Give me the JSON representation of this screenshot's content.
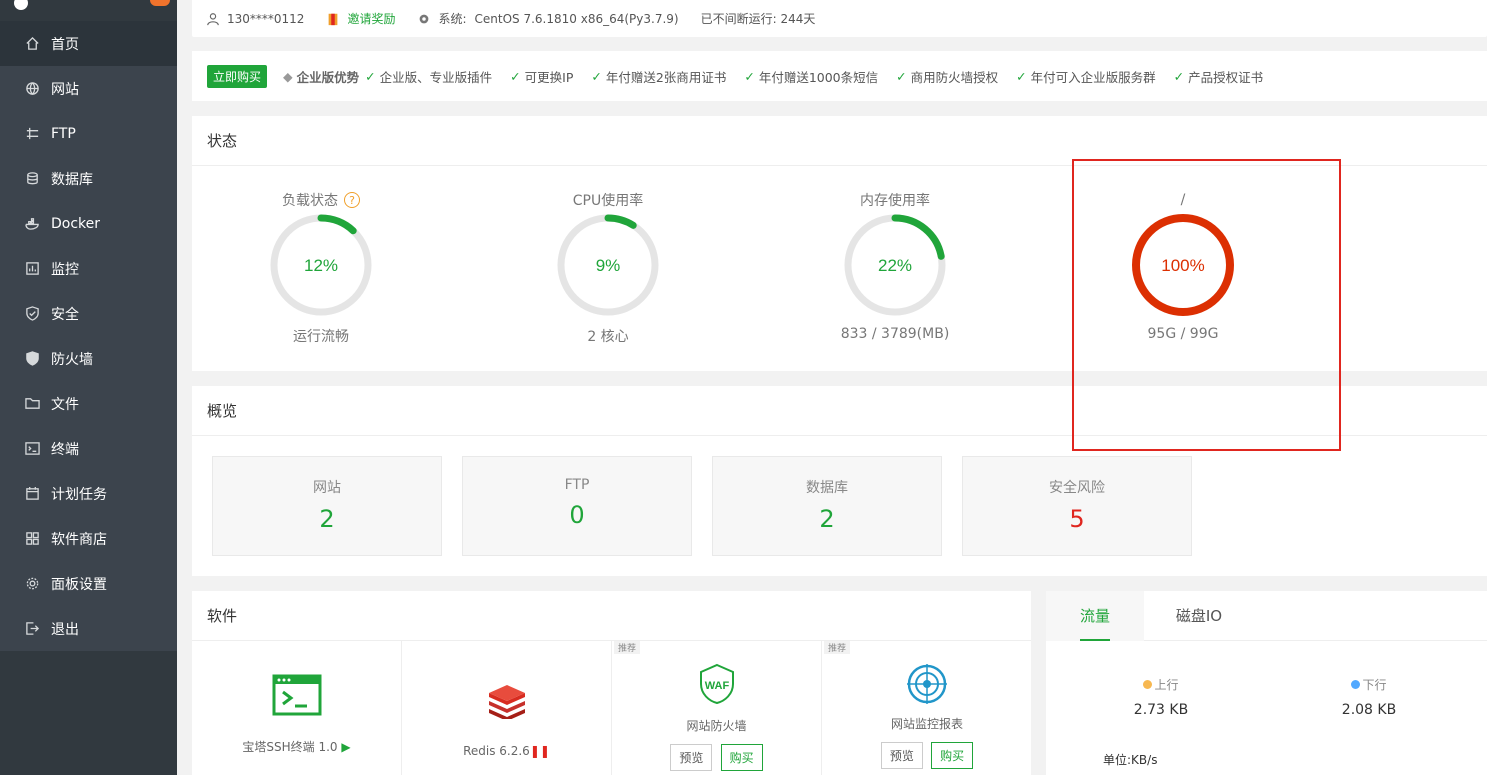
{
  "sidebar": {
    "items": [
      {
        "label": "首页",
        "icon": "home-icon"
      },
      {
        "label": "网站",
        "icon": "globe-icon"
      },
      {
        "label": "FTP",
        "icon": "ftp-icon"
      },
      {
        "label": "数据库",
        "icon": "database-icon"
      },
      {
        "label": "Docker",
        "icon": "docker-icon"
      },
      {
        "label": "监控",
        "icon": "monitor-icon"
      },
      {
        "label": "安全",
        "icon": "shield-icon"
      },
      {
        "label": "防火墙",
        "icon": "firewall-icon"
      },
      {
        "label": "文件",
        "icon": "folder-icon"
      },
      {
        "label": "终端",
        "icon": "terminal-icon"
      },
      {
        "label": "计划任务",
        "icon": "calendar-icon"
      },
      {
        "label": "软件商店",
        "icon": "apps-icon"
      },
      {
        "label": "面板设置",
        "icon": "gear-icon"
      },
      {
        "label": "退出",
        "icon": "logout-icon"
      }
    ]
  },
  "topbar": {
    "user": "130****0112",
    "invite": "邀请奖励",
    "system_label": "系统:",
    "system": "CentOS 7.6.1810 x86_64(Py3.7.9)",
    "uptime": "已不间断运行: 244天"
  },
  "banner": {
    "buy": "立即购买",
    "title": "企业版优势",
    "features": [
      "企业版、专业版插件",
      "可更换IP",
      "年付赠送2张商用证书",
      "年付赠送1000条短信",
      "商用防火墙授权",
      "年付可入企业版服务群",
      "产品授权证书"
    ]
  },
  "status": {
    "title": "状态",
    "gauges": [
      {
        "name": "负载状态",
        "value": "12%",
        "percent": 12,
        "sub": "运行流畅",
        "color": "#20a53a"
      },
      {
        "name": "CPU使用率",
        "value": "9%",
        "percent": 9,
        "sub": "2 核心",
        "color": "#20a53a"
      },
      {
        "name": "内存使用率",
        "value": "22%",
        "percent": 22,
        "sub": "833 / 3789(MB)",
        "color": "#20a53a"
      },
      {
        "name": "/",
        "value": "100%",
        "percent": 100,
        "sub": "95G / 99G",
        "color": "#dc2f02"
      }
    ]
  },
  "overview": {
    "title": "概览",
    "cards": [
      {
        "label": "网站",
        "value": "2",
        "color": "#20a53a"
      },
      {
        "label": "FTP",
        "value": "0",
        "color": "#20a53a"
      },
      {
        "label": "数据库",
        "value": "2",
        "color": "#20a53a"
      },
      {
        "label": "安全风险",
        "value": "5",
        "color": "#e0261f"
      }
    ]
  },
  "software": {
    "title": "软件",
    "items": [
      {
        "name": "宝塔SSH终端 1.0",
        "tag": "",
        "buttons": []
      },
      {
        "name": "Redis 6.2.6",
        "tag": "",
        "buttons": []
      },
      {
        "name": "网站防火墙",
        "tag": "推荐",
        "buttons": [
          "预览",
          "购买"
        ]
      },
      {
        "name": "网站监控报表",
        "tag": "推荐",
        "buttons": [
          "预览",
          "购买"
        ]
      }
    ]
  },
  "traffic": {
    "tabs": [
      "流量",
      "磁盘IO"
    ],
    "up_label": "上行",
    "up_value": "2.73 KB",
    "down_label": "下行",
    "down_value": "2.08 KB",
    "unit": "单位:KB/s"
  }
}
